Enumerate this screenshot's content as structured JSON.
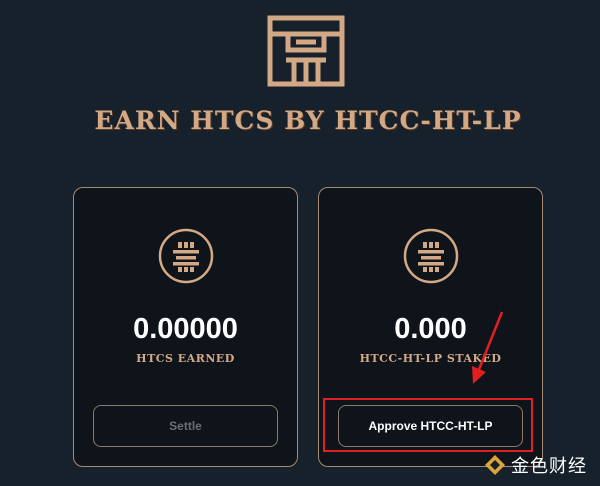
{
  "header": {
    "title": "EARN HTCS BY HTCC-HT-LP",
    "logo_icon": "temple-logo-icon"
  },
  "colors": {
    "background": "#16212b",
    "card_background": "#0f141b",
    "accent_gold": "#d3a985",
    "annotation_red": "#e02020"
  },
  "cards": [
    {
      "icon": "token-coin-icon",
      "amount": "0.00000",
      "label": "HTCS EARNED",
      "button_label": "Settle"
    },
    {
      "icon": "token-coin-icon",
      "amount": "0.000",
      "label": "HTCC-HT-LP STAKED",
      "button_label": "Approve HTCC-HT-LP"
    }
  ],
  "watermark": {
    "text": "金色财经",
    "icon": "diamond-logo-icon"
  }
}
